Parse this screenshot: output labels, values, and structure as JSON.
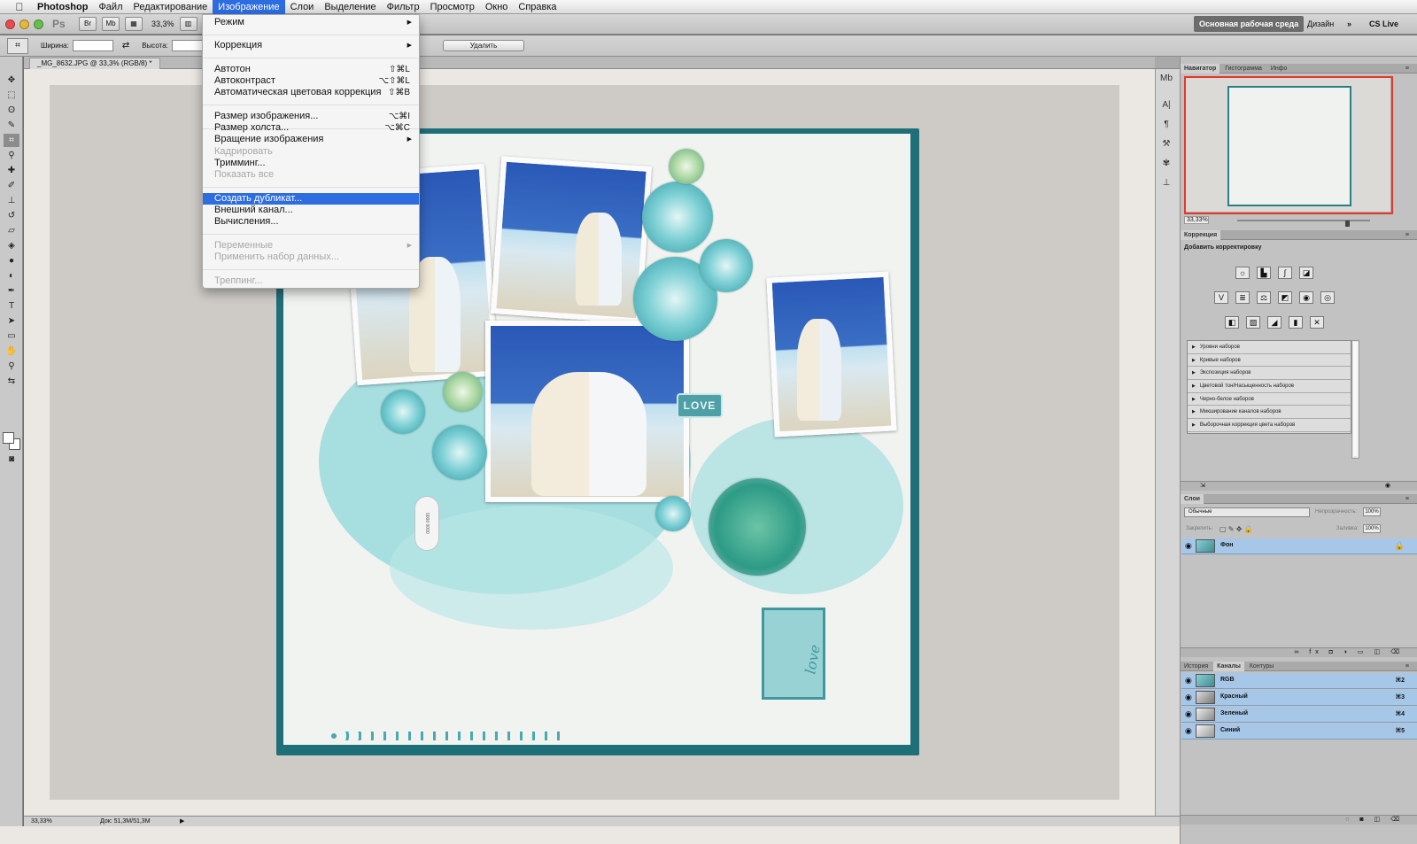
{
  "menubar": {
    "app_name": "Photoshop",
    "items": [
      "Файл",
      "Редактирование",
      "Изображение",
      "Слои",
      "Выделение",
      "Фильтр",
      "Просмотр",
      "Окно",
      "Справка"
    ]
  },
  "appbar": {
    "ps_logo": "Ps",
    "zoom": "33,3%",
    "workspace_main": "Основная рабочая среда",
    "workspace_design": "Дизайн",
    "workspace_more": "»",
    "cs_live": "CS Live"
  },
  "options": {
    "width_label": "Ширина:",
    "height_label": "Высота:",
    "width_value": "",
    "height_value": "",
    "delete_label": "Удалить"
  },
  "document": {
    "tab_title": "_MG_8632.JPG @ 33,3% (RGB/8) *",
    "love_tag": "LOVE",
    "love_script": "love",
    "zip_text": "0000 0000",
    "status_zoom": "33,33%",
    "status_doc": "Док: 51,3M/51,3M"
  },
  "image_menu": {
    "items": [
      {
        "label": "Режим",
        "shortcut": "",
        "submenu": true,
        "disabled": false
      },
      {
        "label": "Коррекция",
        "shortcut": "",
        "submenu": true,
        "disabled": false
      },
      {
        "label": "Автотон",
        "shortcut": "⇧⌘L",
        "submenu": false,
        "disabled": false
      },
      {
        "label": "Автоконтраст",
        "shortcut": "⌥⇧⌘L",
        "submenu": false,
        "disabled": false
      },
      {
        "label": "Автоматическая цветовая коррекция",
        "shortcut": "⇧⌘B",
        "submenu": false,
        "disabled": false
      },
      {
        "label": "Размер изображения...",
        "shortcut": "⌥⌘I",
        "submenu": false,
        "disabled": false
      },
      {
        "label": "Размер холста...",
        "shortcut": "⌥⌘C",
        "submenu": false,
        "disabled": false
      },
      {
        "label": "Вращение изображения",
        "shortcut": "",
        "submenu": true,
        "disabled": false
      },
      {
        "label": "Кадрировать",
        "shortcut": "",
        "submenu": false,
        "disabled": true
      },
      {
        "label": "Тримминг...",
        "shortcut": "",
        "submenu": false,
        "disabled": false
      },
      {
        "label": "Показать все",
        "shortcut": "",
        "submenu": false,
        "disabled": true
      },
      {
        "label": "Создать дубликат...",
        "shortcut": "",
        "submenu": false,
        "disabled": false,
        "highlighted": true
      },
      {
        "label": "Внешний канал...",
        "shortcut": "",
        "submenu": false,
        "disabled": false
      },
      {
        "label": "Вычисления...",
        "shortcut": "",
        "submenu": false,
        "disabled": false
      },
      {
        "label": "Переменные",
        "shortcut": "",
        "submenu": true,
        "disabled": true
      },
      {
        "label": "Применить набор данных...",
        "shortcut": "",
        "submenu": false,
        "disabled": true
      },
      {
        "label": "Треппинг...",
        "shortcut": "",
        "submenu": false,
        "disabled": true
      }
    ]
  },
  "navigator": {
    "tabs": [
      "Навигатор",
      "Гистограмма",
      "Инфо"
    ],
    "zoom": "33,33%"
  },
  "adjustments": {
    "tab": "Коррекция",
    "subtitle": "Добавить корректировку",
    "presets": [
      "Уровни наборов",
      "Кривые наборов",
      "Экспозиция наборов",
      "Цветовой тон/Насыщенность наборов",
      "Черно-белое наборов",
      "Микширование каналов наборов",
      "Выборочная коррекция цвета наборов"
    ]
  },
  "layers": {
    "tab": "Слои",
    "blend_mode": "Обычные",
    "opacity_label": "Непрозрачность:",
    "opacity_value": "100%",
    "lock_label": "Закрепить:",
    "fill_label": "Заливка:",
    "fill_value": "100%",
    "layer_name": "Фон"
  },
  "channels": {
    "tabs": [
      "История",
      "Каналы",
      "Контуры"
    ],
    "items": [
      {
        "name": "RGB",
        "shortcut": "⌘2"
      },
      {
        "name": "Красный",
        "shortcut": "⌘3"
      },
      {
        "name": "Зеленый",
        "shortcut": "⌘4"
      },
      {
        "name": "Синий",
        "shortcut": "⌘5"
      }
    ]
  },
  "colors": {
    "menu_highlight": "#2d6de0",
    "layer_selected": "#a7c7e8",
    "navigator_frame": "#e3392b",
    "page_border": "#1f6f78"
  }
}
